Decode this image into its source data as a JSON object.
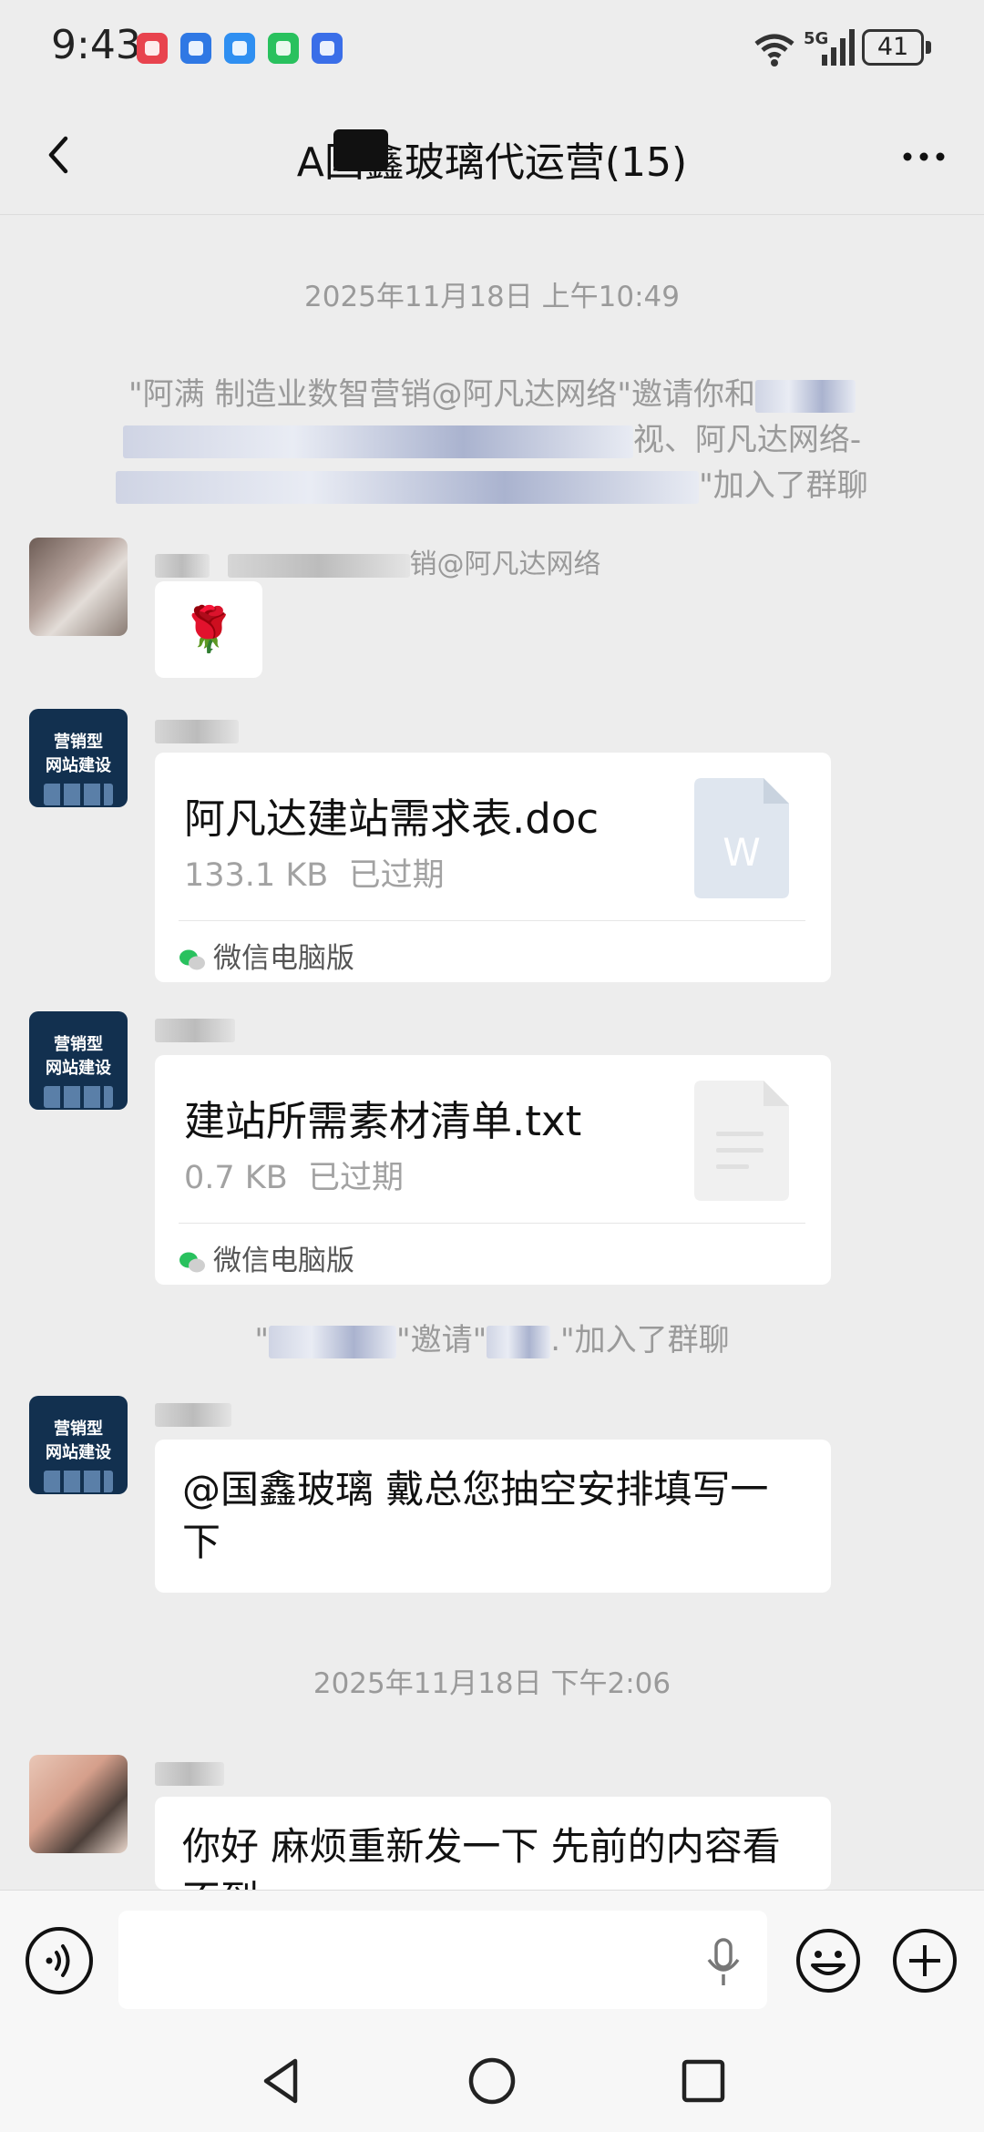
{
  "status_bar": {
    "time": "9:43",
    "network": "5G",
    "battery": "41",
    "app_icons": [
      {
        "name": "book-app-icon",
        "color": "#e8434e"
      },
      {
        "name": "bulb-app-icon",
        "color": "#2f78e4"
      },
      {
        "name": "message-app-icon",
        "color": "#2f8ff1"
      },
      {
        "name": "wechat-app-icon",
        "color": "#29c15e"
      },
      {
        "name": "voice-app-icon",
        "color": "#3a6ee8"
      }
    ]
  },
  "header": {
    "title": "A国鑫玻璃代运营(15)"
  },
  "messages": {
    "timestamp1": "2025年11月18日 上午10:49",
    "invite1": {
      "line1": "\"阿满 制造业数智营销@阿凡达网络\"邀请你和",
      "line2": "视、阿凡达网络-",
      "line3": "\"加入了群聊"
    },
    "msg1": {
      "sender": "销@阿凡达网络",
      "content": "🌹"
    },
    "msg2": {
      "file_name": "阿凡达建站需求表.doc",
      "file_size": "133.1 KB",
      "file_status": "已过期",
      "source": "微信电脑版",
      "icon_letter": "W"
    },
    "msg3": {
      "file_name": "建站所需素材清单.txt",
      "file_size": "0.7 KB",
      "file_status": "已过期",
      "source": "微信电脑版"
    },
    "invite2": {
      "part1": "\"",
      "part2": "\"邀请\"",
      "part3": ".\"加入了群聊"
    },
    "msg4": {
      "content": "@国鑫玻璃  戴总您抽空安排填写一下"
    },
    "timestamp2": "2025年11月18日 下午2:06",
    "msg5": {
      "content": "你好 麻烦重新发一下  先前的内容看不到"
    }
  },
  "avatar_poster": {
    "line1": "营销型",
    "line2": "网站建设"
  },
  "input_bar": {
    "placeholder": ""
  },
  "colors": {
    "background": "#ededed",
    "bubble": "#ffffff",
    "word_icon": "#dfe6ef",
    "wechat_green": "#29c15e"
  }
}
